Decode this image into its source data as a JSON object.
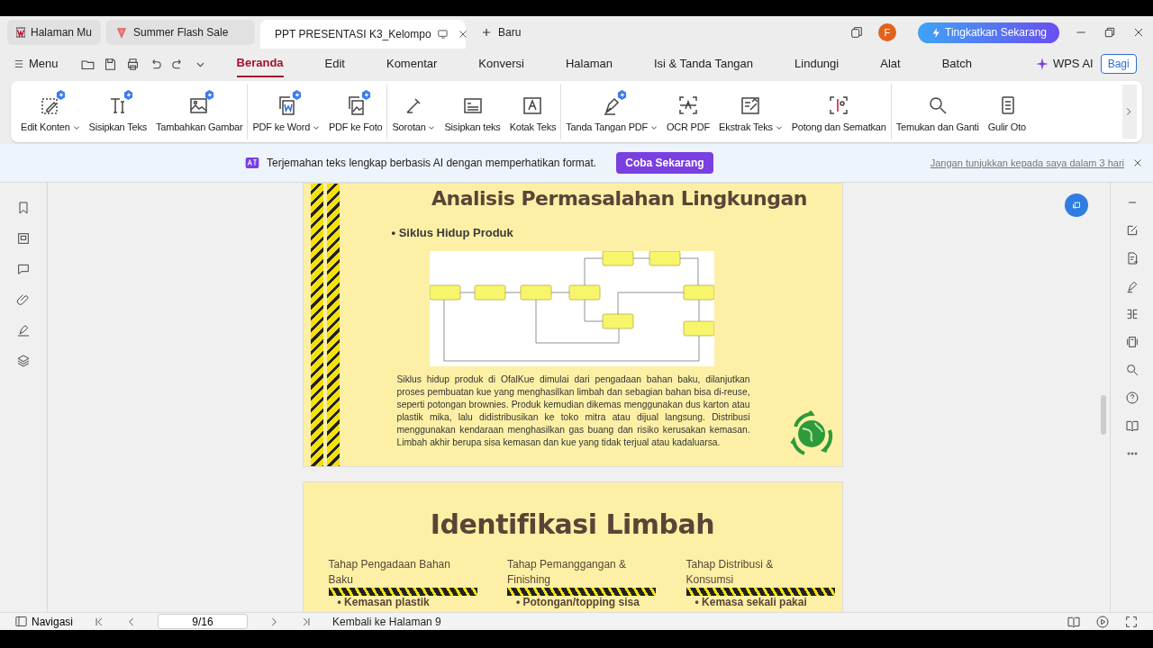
{
  "tabs": [
    {
      "label": "Halaman Mu",
      "selected": false
    },
    {
      "label": "Summer Flash Sale",
      "selected": false
    },
    {
      "label": "PPT PRESENTASI K3_Kelompo",
      "selected": true
    }
  ],
  "new_tab": "Baru",
  "avatar": "F",
  "upgrade_button": "Tingkatkan Sekarang",
  "menu_button": "Menu",
  "menu_tabs": [
    {
      "label": "Beranda",
      "selected": true
    },
    {
      "label": "Edit",
      "selected": false
    },
    {
      "label": "Komentar",
      "selected": false
    },
    {
      "label": "Konversi",
      "selected": false
    },
    {
      "label": "Halaman",
      "selected": false
    },
    {
      "label": "Isi & Tanda Tangan",
      "selected": false
    },
    {
      "label": "Lindungi",
      "selected": false
    },
    {
      "label": "Alat",
      "selected": false
    },
    {
      "label": "Batch",
      "selected": false
    }
  ],
  "ai_button": "WPS AI",
  "share_button": "Bagi",
  "ribbon": [
    [
      {
        "label": "Edit Konten",
        "dropdown": true,
        "ai_badge": true
      },
      {
        "label": "Sisipkan Teks",
        "dropdown": false,
        "ai_badge": true
      },
      {
        "label": "Tambahkan Gambar",
        "dropdown": false,
        "ai_badge": true
      }
    ],
    [
      {
        "label": "PDF ke Word",
        "dropdown": true,
        "ai_badge": true
      },
      {
        "label": "PDF ke Foto",
        "dropdown": false,
        "ai_badge": true
      }
    ],
    [
      {
        "label": "Sorotan",
        "dropdown": true,
        "ai_badge": false
      },
      {
        "label": "Sisipkan teks",
        "dropdown": false,
        "ai_badge": false
      },
      {
        "label": "Kotak Teks",
        "dropdown": false,
        "ai_badge": false
      }
    ],
    [
      {
        "label": "Tanda Tangan PDF",
        "dropdown": true,
        "ai_badge": true
      },
      {
        "label": "OCR PDF",
        "dropdown": false,
        "ai_badge": false
      },
      {
        "label": "Ekstrak Teks",
        "dropdown": true,
        "ai_badge": false
      },
      {
        "label": "Potong dan Sematkan",
        "dropdown": false,
        "ai_badge": false
      }
    ],
    [
      {
        "label": "Temukan dan Ganti",
        "dropdown": false,
        "ai_badge": false
      },
      {
        "label": "Gulir Oto",
        "dropdown": false,
        "ai_badge": false
      }
    ]
  ],
  "banner": {
    "text": "Terjemahan teks lengkap berbasis AI dengan memperhatikan format.",
    "button": "Coba Sekarang",
    "dismiss_link": "Jangan tunjukkan kepada saya dalam 3 hari"
  },
  "pages": [
    {
      "title": "Analisis Permasalahan Lingkungan",
      "bullet": "• Siklus Hidup Produk",
      "paragraph": "Siklus hidup produk di OfalKue dimulai dari pengadaan bahan baku, dilanjutkan proses pembuatan kue yang menghasilkan limbah dan sebagian bahan bisa di-reuse, seperti potongan brownies. Produk kemudian dikemas menggunakan dus karton atau plastik mika, lalu didistribusikan ke toko mitra atau dijual langsung. Distribusi menggunakan kendaraan menghasilkan gas buang dan risiko kerusakan kemasan. Limbah akhir berupa sisa kemasan dan kue yang tidak terjual atau kadaluarsa."
    },
    {
      "title": "Identifikasi Limbah",
      "columns": [
        {
          "heading": "Tahap Pengadaan Bahan Baku",
          "items": [
            "• Kemasan plastik"
          ]
        },
        {
          "heading": "Tahap Pemanggangan & Finishing",
          "items": [
            "• Potongan/topping sisa"
          ]
        },
        {
          "heading": "Tahap Distribusi & Konsumsi",
          "items": [
            "• Kemasa sekali pakai"
          ]
        }
      ]
    }
  ],
  "status_bar": {
    "navigation": "Navigasi",
    "page_field": "9/16",
    "back_link": "Kembali ke Halaman 9"
  }
}
